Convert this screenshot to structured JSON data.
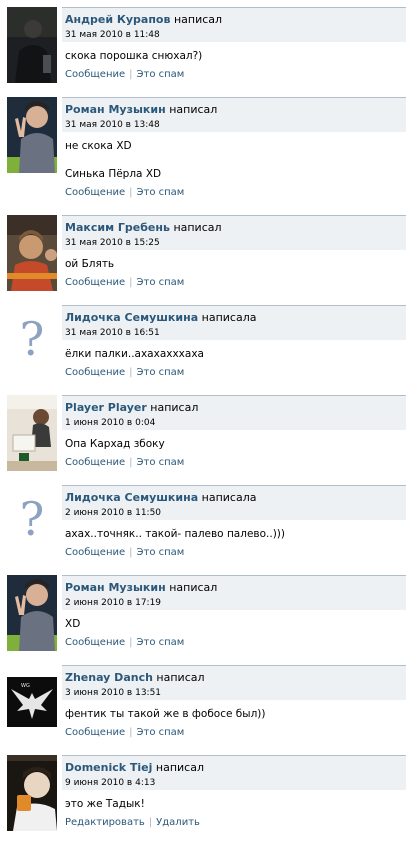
{
  "posts": [
    {
      "author": "Андрей Курапов",
      "verb": "написал",
      "date": "31 мая 2010 в 11:48",
      "lines": [
        "скока порошка снюхал?)"
      ],
      "actions": [
        "Сообщение",
        "Это спам"
      ],
      "avatar": "dark-photo"
    },
    {
      "author": "Роман Музыкин",
      "verb": "написал",
      "date": "31 мая 2010 в 13:48",
      "lines": [
        "не скока XD",
        "",
        "Синька Пёрла XD"
      ],
      "actions": [
        "Сообщение",
        "Это спам"
      ],
      "avatar": "boy-peace-photo"
    },
    {
      "author": "Максим Гребень",
      "verb": "написал",
      "date": "31 мая 2010 в 15:25",
      "lines": [
        "ой Блять"
      ],
      "actions": [
        "Сообщение",
        "Это спам"
      ],
      "avatar": "group-photo"
    },
    {
      "author": "Лидочка Семушкина",
      "verb": "написала",
      "date": "31 мая 2010 в 16:51",
      "lines": [
        "ёлки палки..ахахахххаха"
      ],
      "actions": [
        "Сообщение",
        "Это спам"
      ],
      "avatar": "question-mark-placeholder"
    },
    {
      "author": "Player Player",
      "verb": "написал",
      "date": "1 июня 2010 в 0:04",
      "lines": [
        "Опа Кархад збоку"
      ],
      "actions": [
        "Сообщение",
        "Это спам"
      ],
      "avatar": "desk-photo"
    },
    {
      "author": "Лидочка Семушкина",
      "verb": "написала",
      "date": "2 июня 2010 в 11:50",
      "lines": [
        "ахах..точняк.. такой- палево палево..)))"
      ],
      "actions": [
        "Сообщение",
        "Это спам"
      ],
      "avatar": "question-mark-placeholder"
    },
    {
      "author": "Роман Музыкин",
      "verb": "написал",
      "date": "2 июня 2010 в 17:19",
      "lines": [
        "XD"
      ],
      "actions": [
        "Сообщение",
        "Это спам"
      ],
      "avatar": "boy-peace-photo"
    },
    {
      "author": "Zhenay Danch",
      "verb": "написал",
      "date": "3 июня 2010 в 13:51",
      "lines": [
        "фентик ты такой же в фобосе был))"
      ],
      "actions": [
        "Сообщение",
        "Это спам"
      ],
      "avatar": "eagle-logo"
    },
    {
      "author": "Domenick Tiej",
      "verb": "написал",
      "date": "9 июня 2010 в 4:13",
      "lines": [
        "это же Тадык!"
      ],
      "actions": [
        "Редактировать",
        "Удалить"
      ],
      "avatar": "cup-photo"
    }
  ],
  "colors": {
    "link": "#2b587a",
    "header_bg": "#eef1f4",
    "header_border": "#b1bdcb"
  }
}
